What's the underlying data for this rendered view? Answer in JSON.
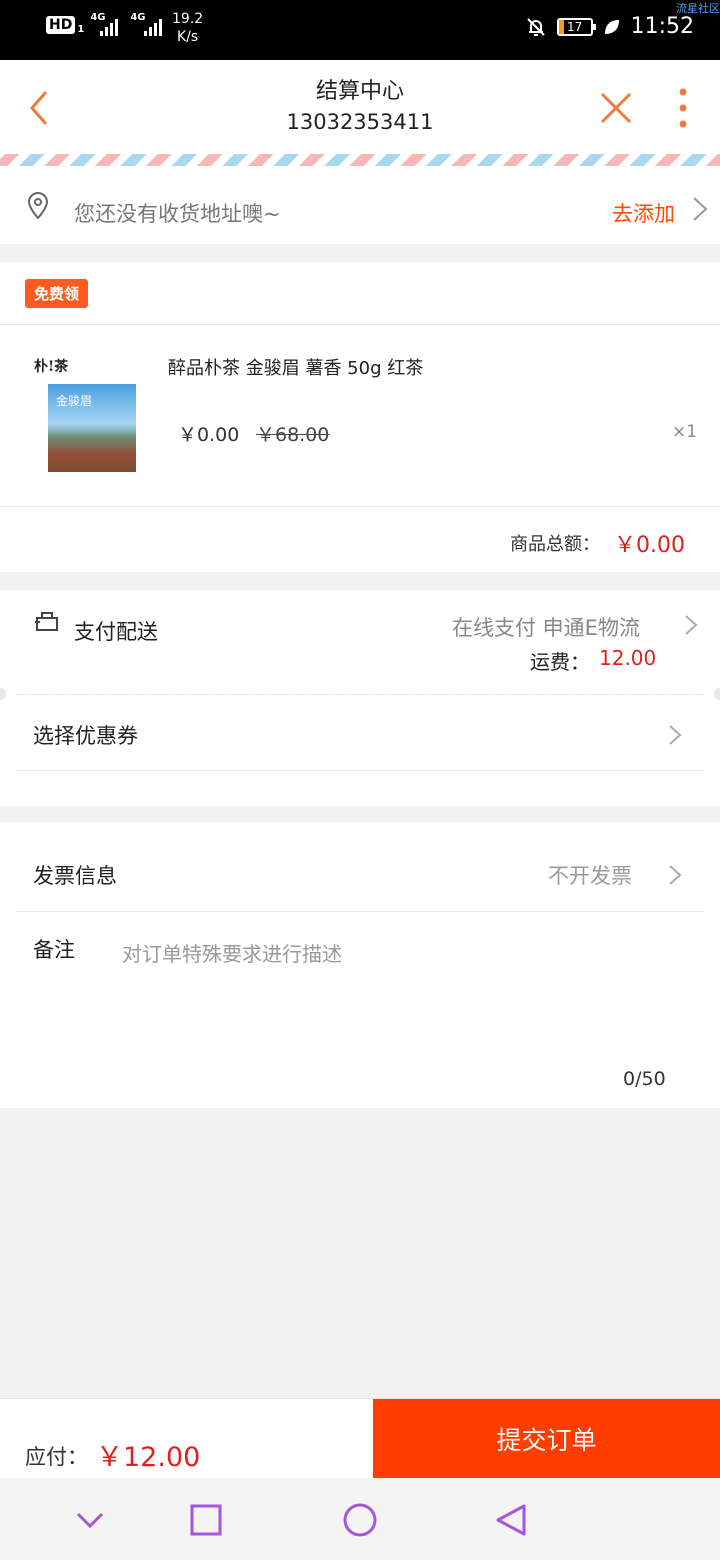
{
  "status_bar": {
    "hd": "HD",
    "hd_sub": "1",
    "network_1": "4G",
    "network_2": "4G",
    "speed_value": "19.2",
    "speed_unit": "K/s",
    "battery": "17",
    "time": "11:52",
    "watermark": "流星社区"
  },
  "header": {
    "title": "结算中心",
    "subtitle": "13032353411"
  },
  "address": {
    "placeholder": "您还没有收货地址噢~",
    "action": "去添加"
  },
  "goods": {
    "badge": "免费领",
    "thumb_brand": "朴!茶",
    "thumb_caption": "金骏眉",
    "name": "醉品朴茶 金骏眉 薯香 50g 红茶",
    "price": "￥0.00",
    "original_price": "￥68.00",
    "quantity": "×1",
    "total_label": "商品总额：",
    "total_value": "￥0.00"
  },
  "delivery": {
    "label": "支付配送",
    "value": "在线支付  申通E物流",
    "shipping_label": "运费：",
    "shipping_value": "12.00"
  },
  "coupon": {
    "label": "选择优惠券"
  },
  "invoice": {
    "label": "发票信息",
    "value": "不开发票"
  },
  "remarks": {
    "label": "备注",
    "placeholder": "对订单特殊要求进行描述",
    "counter": "0/50"
  },
  "footer": {
    "pay_label": "应付：",
    "pay_value": "￥12.00",
    "submit_label": "提交订单"
  },
  "colors": {
    "accent": "#ff3d00",
    "price": "#e02020",
    "nav_icon": "#f07a3a",
    "sys_nav": "#a855d8"
  }
}
